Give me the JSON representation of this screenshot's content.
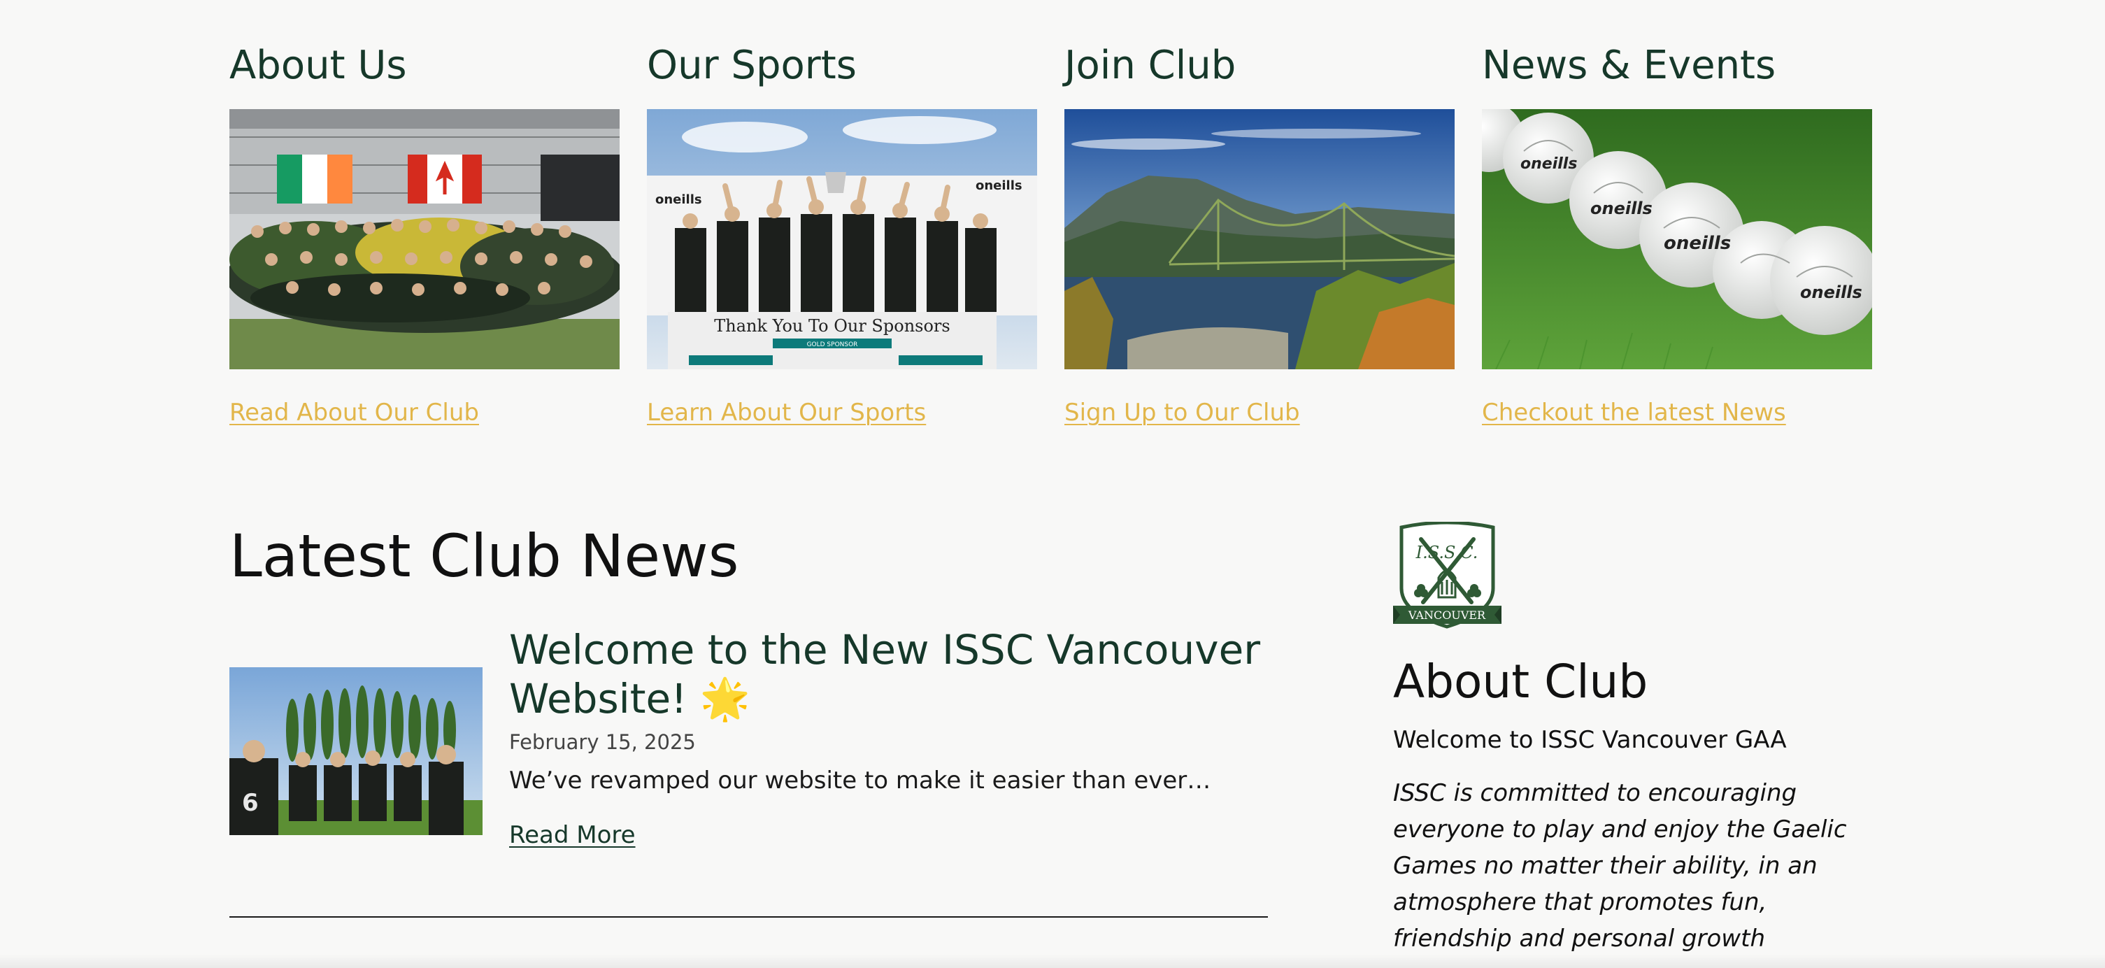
{
  "cards": [
    {
      "title": "About Us",
      "link": "Read About Our Club"
    },
    {
      "title": "Our Sports",
      "link": "Learn About Our Sports"
    },
    {
      "title": "Join Club",
      "link": "Sign Up to Our Club"
    },
    {
      "title": "News & Events",
      "link": "Checkout the latest News"
    }
  ],
  "card_images": {
    "sponsor_banner_text": "Thank You To Our Sponsors",
    "gold_sponsor": "GOLD SPONSOR",
    "brand": "oneills"
  },
  "news": {
    "heading": "Latest Club News",
    "posts": [
      {
        "title": "Welcome to the New ISSC Vancouver Website! 🌟",
        "date": "February 15, 2025",
        "excerpt": "We’ve revamped our website to make it easier than ever…",
        "more": "Read More"
      }
    ]
  },
  "sidebar": {
    "crest_initials": "I.S.S.C.",
    "crest_banner": "VANCOUVER",
    "heading": "About Club",
    "welcome": "Welcome to ISSC Vancouver GAA",
    "mission": "ISSC is committed to encouraging everyone to play and enjoy the Gaelic Games no matter their ability, in an atmosphere that promotes fun, friendship and personal growth"
  },
  "colors": {
    "background": "#f8f8f7",
    "heading_green": "#16382a",
    "link_gold": "#e2b64a",
    "crest_green": "#2f5a35"
  }
}
